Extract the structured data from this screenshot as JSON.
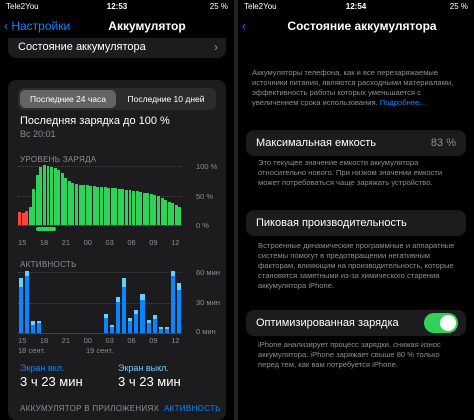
{
  "left": {
    "status": {
      "carrier": "Tele2You",
      "time": "12:53",
      "battery": "25 %"
    },
    "nav": {
      "back_label": "Настройки",
      "title": "Аккумулятор"
    },
    "battery_state_row": "Состояние аккумулятора",
    "segments": [
      "Последние 24 часа",
      "Последние 10 дней"
    ],
    "last_charge": {
      "title": "Последняя зарядка до 100 %",
      "time": "Вс 20:01"
    },
    "level_label": "УРОВЕНЬ ЗАРЯДА",
    "level_y_ticks": [
      "100 %",
      "50 %",
      "0 %"
    ],
    "level_x_ticks": [
      "15",
      "18",
      "21",
      "00",
      "03",
      "06",
      "09",
      "12"
    ],
    "activity_label": "АКТИВНОСТЬ",
    "activity_y_ticks": [
      "60 мин",
      "30 мин",
      "0 мин"
    ],
    "activity_x_ticks": [
      "15",
      "18",
      "21",
      "00",
      "03",
      "06",
      "09",
      "12"
    ],
    "activity_date_labels": [
      "18 сент.",
      "19 сент."
    ],
    "screen_on_label": "Экран вкл.",
    "screen_on_value": "3 ч 23 мин",
    "screen_off_label": "Экран выкл.",
    "screen_off_value": "3 ч 23 мин",
    "apps_label": "АККУМУЛЯТОР В ПРИЛОЖЕНИЯХ",
    "activity_link": "АКТИВНОСТЬ"
  },
  "right": {
    "status": {
      "carrier": "Tele2You",
      "time": "12:54",
      "battery": "25 %"
    },
    "nav": {
      "title": "Состояние аккумулятора"
    },
    "intro": "Аккумуляторы телефона, как и все перезаряжаемые источники питания, являются расходными материалами, эффективность работы которых уменьшается с увеличением срока использования.",
    "intro_link": "Подробнее…",
    "max_capacity_label": "Максимальная емкость",
    "max_capacity_value": "83 %",
    "max_capacity_desc": "Это текущее значение емкости аккумулятора относительно нового. При низком значении емкости может потребоваться чаще заряжать устройство.",
    "peak_label": "Пиковая производительность",
    "peak_desc": "Встроенные динамические программные и аппаратные системы помогут в предотвращении негативным факторам, влияющим на производительность, которые становятся заметными из-за химического старения аккумулятора iPhone.",
    "optimized_label": "Оптимизированная зарядка",
    "optimized_on": true,
    "optimized_desc": "iPhone анализирует процесс зарядки, снижая износ аккумулятора. iPhone заряжает свыше 80 % только перед тем, как вам потребуется iPhone."
  },
  "chart_data": [
    {
      "type": "bar",
      "title": "УРОВЕНЬ ЗАРЯДА",
      "ylim": [
        0,
        100
      ],
      "y_tick_labels": [
        "100 %",
        "50 %",
        "0 %"
      ],
      "x_tick_labels": [
        "15",
        "18",
        "21",
        "00",
        "03",
        "06",
        "09",
        "12"
      ],
      "values": [
        22,
        20,
        24,
        30,
        60,
        84,
        96,
        100,
        99,
        97,
        95,
        91,
        86,
        78,
        73,
        70,
        68,
        67,
        66,
        66,
        65,
        65,
        64,
        64,
        63,
        62,
        62,
        61,
        60,
        60,
        59,
        58,
        57,
        56,
        55,
        54,
        53,
        52,
        50,
        48,
        45,
        42,
        39,
        36,
        33,
        30
      ],
      "colors": {
        "charging": "#30d158",
        "discharging": "#30d158",
        "low": "#ff453a"
      }
    },
    {
      "type": "bar",
      "title": "АКТИВНОСТЬ",
      "ylim": [
        0,
        60
      ],
      "y_tick_labels": [
        "60 мин",
        "30 мин",
        "0 мин"
      ],
      "x_tick_labels": [
        "15",
        "18",
        "21",
        "00",
        "03",
        "06",
        "09",
        "12"
      ],
      "series": [
        {
          "name": "Экран вкл.",
          "values": [
            45,
            55,
            8,
            10,
            0,
            0,
            0,
            0,
            0,
            0,
            0,
            0,
            0,
            0,
            15,
            6,
            30,
            45,
            12,
            18,
            32,
            10,
            14,
            4,
            4,
            55,
            42
          ]
        },
        {
          "name": "Экран выкл.",
          "values": [
            8,
            5,
            4,
            2,
            0,
            0,
            0,
            0,
            0,
            0,
            0,
            0,
            0,
            0,
            3,
            2,
            5,
            8,
            3,
            4,
            6,
            3,
            3,
            2,
            2,
            5,
            6
          ]
        }
      ],
      "colors": {
        "on": "#0a84ff",
        "off": "#64d2ff"
      }
    }
  ]
}
